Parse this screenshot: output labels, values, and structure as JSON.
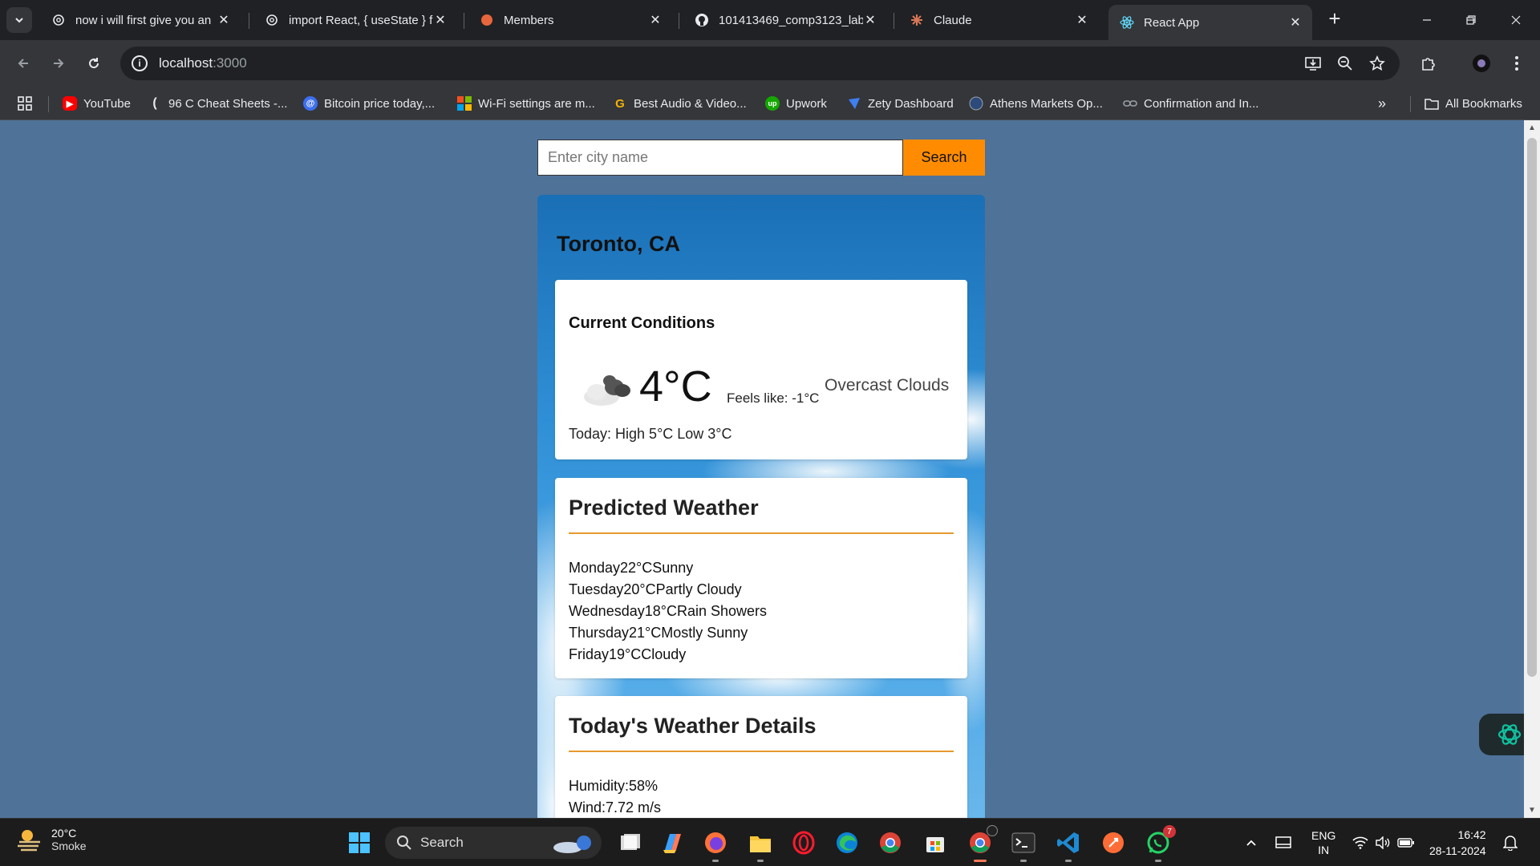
{
  "browser": {
    "tabs": [
      {
        "title": "now i will first give you an",
        "icon": "openai-icon",
        "active": false
      },
      {
        "title": "import React, { useState } fr",
        "icon": "openai-icon",
        "active": false
      },
      {
        "title": "Members",
        "icon": "members-icon",
        "active": false
      },
      {
        "title": "101413469_comp3123_lab",
        "icon": "github-icon",
        "active": false
      },
      {
        "title": "Claude",
        "icon": "claude-icon",
        "active": false
      },
      {
        "title": "React App",
        "icon": "react-icon",
        "active": true
      }
    ],
    "url_host": "localhost",
    "url_port": ":3000",
    "bookmarks": [
      {
        "label": "YouTube",
        "icon": "youtube-icon"
      },
      {
        "label": "96 C Cheat Sheets -...",
        "icon": "bracket-icon"
      },
      {
        "label": "Bitcoin price today,...",
        "icon": "at-icon"
      },
      {
        "label": "Wi-Fi settings are m...",
        "icon": "windows-icon"
      },
      {
        "label": "Best Audio & Video...",
        "icon": "g-icon"
      },
      {
        "label": "Upwork",
        "icon": "upwork-icon"
      },
      {
        "label": "Zety Dashboard",
        "icon": "zety-icon"
      },
      {
        "label": "Athens Markets Op...",
        "icon": "globe-icon"
      },
      {
        "label": "Confirmation and In...",
        "icon": "link-icon"
      }
    ],
    "all_bookmarks": "All Bookmarks"
  },
  "app": {
    "search": {
      "placeholder": "Enter city name",
      "value": "",
      "button": "Search"
    },
    "city": "Toronto, CA",
    "current": {
      "title": "Current Conditions",
      "icon": "cloud-icon",
      "temp": "4°C",
      "feels_like": "Feels like: -1°C",
      "condition": "Overcast Clouds",
      "high_low": "Today: High 5°C Low 3°C"
    },
    "predicted": {
      "title": "Predicted Weather",
      "days": [
        {
          "text": "Monday22°CSunny"
        },
        {
          "text": "Tuesday20°CPartly Cloudy"
        },
        {
          "text": "Wednesday18°CRain Showers"
        },
        {
          "text": "Thursday21°CMostly Sunny"
        },
        {
          "text": "Friday19°CCloudy"
        }
      ]
    },
    "details": {
      "title": "Today's Weather Details",
      "humidity": "Humidity:58%",
      "wind": "Wind:7.72 m/s"
    }
  },
  "taskbar": {
    "weather_temp": "20°C",
    "weather_desc": "Smoke",
    "search_label": "Search",
    "lang_top": "ENG",
    "lang_bottom": "IN",
    "time": "16:42",
    "date": "28-11-2024",
    "chrome_badge": "",
    "whatsapp_badge": "7"
  },
  "colors": {
    "page_bg": "#4f7299",
    "search_button": "#ff8c00",
    "divider": "#e69a2e"
  }
}
